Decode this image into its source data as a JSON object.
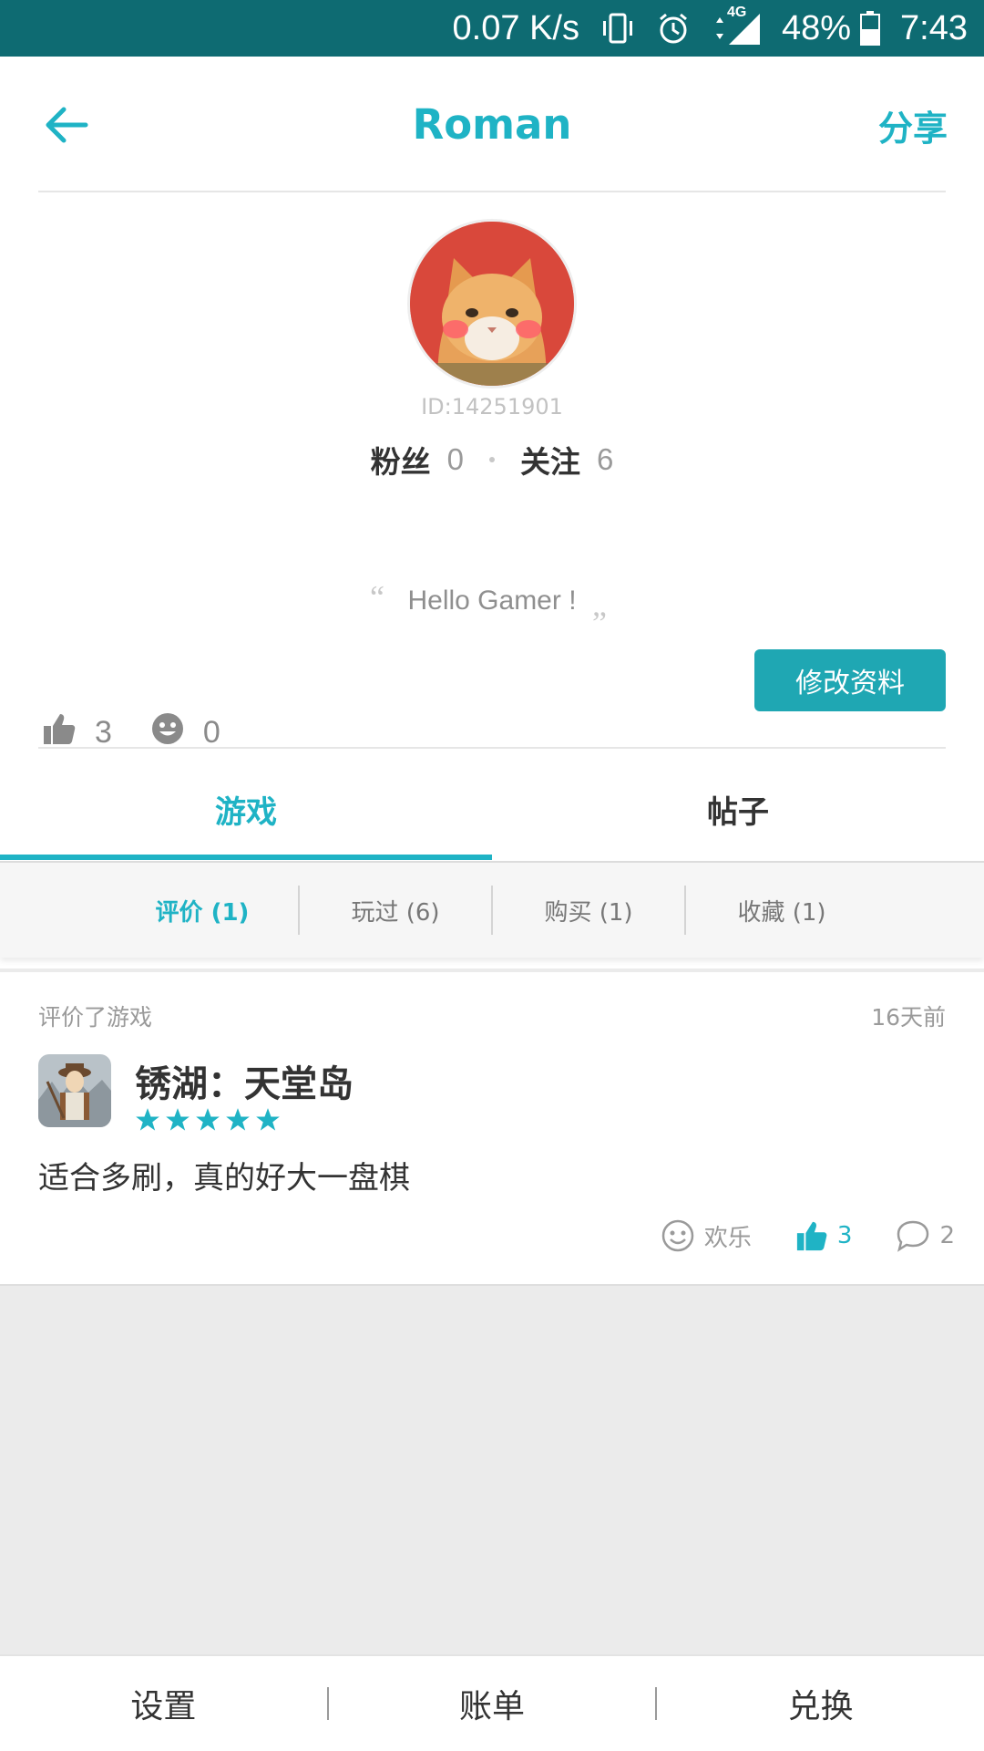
{
  "status_bar": {
    "net_speed": "0.07 K/s",
    "network": "4G",
    "battery": "48%",
    "time": "7:43"
  },
  "header": {
    "title": "Roman",
    "share_label": "分享"
  },
  "profile": {
    "id_text": "ID:14251901",
    "fans_label": "粉丝",
    "fans_count": "0",
    "following_label": "关注",
    "following_count": "6",
    "bio": "Hello Gamer !",
    "likes_count": "3",
    "smile_count": "0",
    "edit_button_label": "修改资料"
  },
  "tabs": [
    {
      "label": "游戏",
      "active": true
    },
    {
      "label": "帖子",
      "active": false
    }
  ],
  "subtabs": [
    {
      "label": "评价 (1)",
      "active": true
    },
    {
      "label": "玩过 (6)",
      "active": false
    },
    {
      "label": "购买 (1)",
      "active": false
    },
    {
      "label": "收藏 (1)",
      "active": false
    }
  ],
  "review": {
    "action": "评价了游戏",
    "time": "16天前",
    "game_name": "锈湖：天堂岛",
    "rating": 5,
    "text": "适合多刷，真的好大一盘棋",
    "mood_label": "欢乐",
    "like_count": "3",
    "comment_count": "2"
  },
  "bottom_nav": [
    {
      "label": "设置"
    },
    {
      "label": "账单"
    },
    {
      "label": "兑换"
    }
  ],
  "colors": {
    "accent": "#1fb3c5",
    "status_bar": "#0e6b72",
    "button": "#1fa7b3"
  }
}
